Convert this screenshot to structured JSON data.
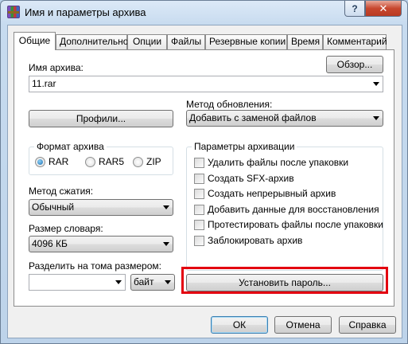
{
  "window": {
    "title": "Имя и параметры архива",
    "help_glyph": "?",
    "close_glyph": "✕"
  },
  "tabs": [
    {
      "label": "Общие",
      "active": true
    },
    {
      "label": "Дополнительно"
    },
    {
      "label": "Опции"
    },
    {
      "label": "Файлы"
    },
    {
      "label": "Резервные копии"
    },
    {
      "label": "Время"
    },
    {
      "label": "Комментарий"
    }
  ],
  "archive_name": {
    "label": "Имя архива:",
    "value": "11.rar",
    "browse_button": "Обзор..."
  },
  "profiles_button": "Профили...",
  "update_method": {
    "label": "Метод обновления:",
    "value": "Добавить с заменой файлов"
  },
  "archive_format": {
    "label": "Формат архива",
    "options": [
      {
        "label": "RAR",
        "checked": true
      },
      {
        "label": "RAR5",
        "checked": false
      },
      {
        "label": "ZIP",
        "checked": false
      }
    ]
  },
  "archive_params": {
    "label": "Параметры архивации",
    "items": [
      {
        "label": "Удалить файлы после упаковки",
        "checked": false
      },
      {
        "label": "Создать SFX-архив",
        "checked": false
      },
      {
        "label": "Создать непрерывный архив",
        "checked": false
      },
      {
        "label": "Добавить данные для восстановления",
        "checked": false
      },
      {
        "label": "Протестировать файлы после упаковки",
        "checked": false
      },
      {
        "label": "Заблокировать архив",
        "checked": false
      }
    ]
  },
  "compression": {
    "label": "Метод сжатия:",
    "value": "Обычный"
  },
  "dictionary": {
    "label": "Размер словаря:",
    "value": "4096 КБ"
  },
  "split": {
    "label": "Разделить на тома размером:",
    "value": "",
    "unit": "байт"
  },
  "set_password_button": "Установить пароль...",
  "footer": {
    "ok": "ОК",
    "cancel": "Отмена",
    "help": "Справка"
  },
  "colors": {
    "highlight": "#e3000f",
    "accent": "#3c7fb1"
  }
}
